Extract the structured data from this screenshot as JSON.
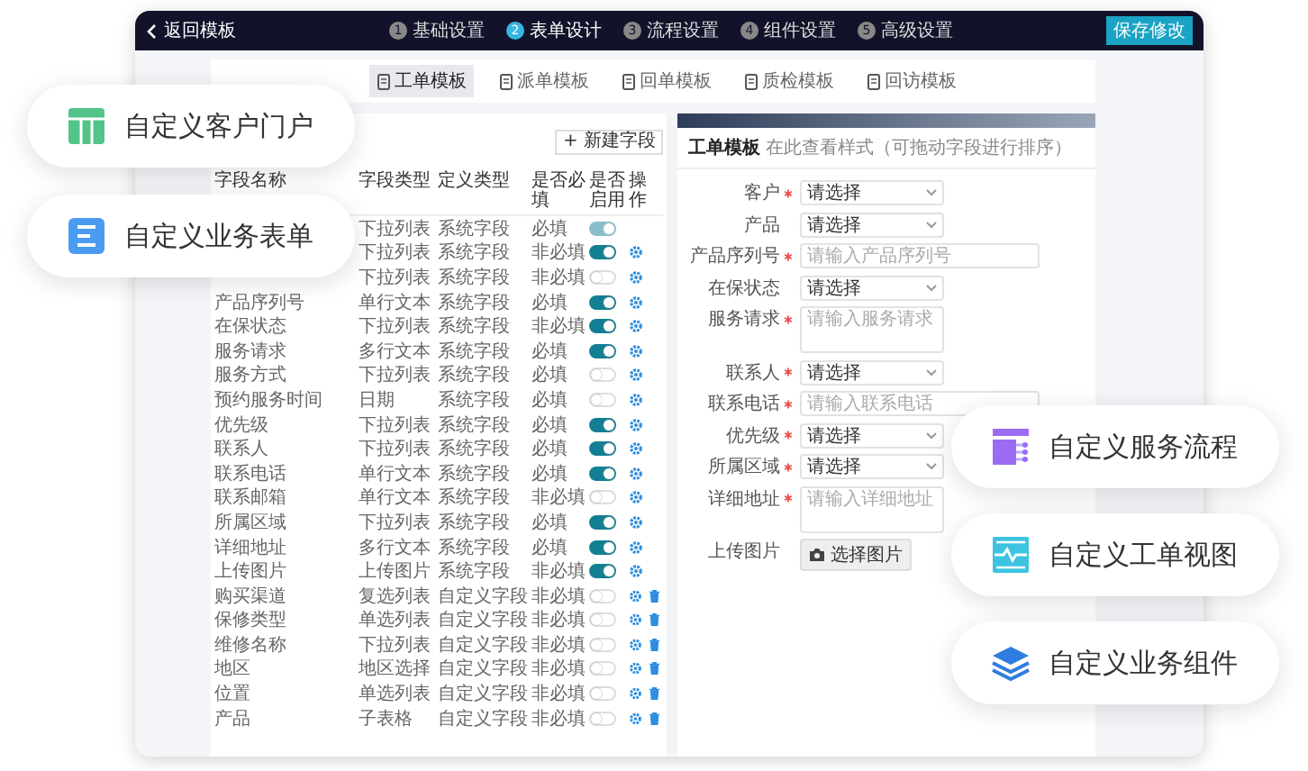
{
  "top_bar": {
    "back_label": "返回模板",
    "steps": [
      {
        "number": "1",
        "label": "基础设置",
        "selected": false
      },
      {
        "number": "2",
        "label": "表单设计",
        "selected": true
      },
      {
        "number": "3",
        "label": "流程设置",
        "selected": false
      },
      {
        "number": "4",
        "label": "组件设置",
        "selected": false
      },
      {
        "number": "5",
        "label": "高级设置",
        "selected": false
      }
    ],
    "save_button": "保存修改"
  },
  "tabs": [
    {
      "label": "工单模板",
      "selected": true
    },
    {
      "label": "派单模板",
      "selected": false
    },
    {
      "label": "回单模板",
      "selected": false
    },
    {
      "label": "质检模板",
      "selected": false
    },
    {
      "label": "回访模板",
      "selected": false
    }
  ],
  "table": {
    "add_button": "+ 新建字段",
    "columns": [
      "字段名称",
      "字段类型",
      "定义类型",
      "是否必填",
      "是否启用",
      "操作"
    ],
    "rows": [
      {
        "type": "下拉列表",
        "definition": "系统字段",
        "required": "必填",
        "enabled": true,
        "locked": true,
        "editable": false,
        "deletable": false
      },
      {
        "type": "下拉列表",
        "definition": "系统字段",
        "required": "非必填",
        "enabled": true,
        "locked": false,
        "editable": true,
        "deletable": false
      },
      {
        "type": "下拉列表",
        "definition": "系统字段",
        "required": "非必填",
        "enabled": false,
        "locked": false,
        "editable": true,
        "deletable": false
      },
      {
        "name": "产品序列号",
        "type": "单行文本",
        "definition": "系统字段",
        "required": "必填",
        "enabled": true,
        "locked": false,
        "editable": true,
        "deletable": false
      },
      {
        "name": "在保状态",
        "type": "下拉列表",
        "definition": "系统字段",
        "required": "非必填",
        "enabled": true,
        "locked": false,
        "editable": true,
        "deletable": false
      },
      {
        "name": "服务请求",
        "type": "多行文本",
        "definition": "系统字段",
        "required": "必填",
        "enabled": true,
        "locked": false,
        "editable": true,
        "deletable": false
      },
      {
        "name": "服务方式",
        "type": "下拉列表",
        "definition": "系统字段",
        "required": "必填",
        "enabled": false,
        "locked": false,
        "editable": true,
        "deletable": false
      },
      {
        "name": "预约服务时间",
        "type": "日期",
        "definition": "系统字段",
        "required": "必填",
        "enabled": false,
        "locked": false,
        "editable": true,
        "deletable": false
      },
      {
        "name": "优先级",
        "type": "下拉列表",
        "definition": "系统字段",
        "required": "必填",
        "enabled": true,
        "locked": false,
        "editable": true,
        "deletable": false
      },
      {
        "name": "联系人",
        "type": "下拉列表",
        "definition": "系统字段",
        "required": "必填",
        "enabled": true,
        "locked": false,
        "editable": true,
        "deletable": false
      },
      {
        "name": "联系电话",
        "type": "单行文本",
        "definition": "系统字段",
        "required": "必填",
        "enabled": true,
        "locked": false,
        "editable": true,
        "deletable": false
      },
      {
        "name": "联系邮箱",
        "type": "单行文本",
        "definition": "系统字段",
        "required": "非必填",
        "enabled": false,
        "locked": false,
        "editable": true,
        "deletable": false
      },
      {
        "name": "所属区域",
        "type": "下拉列表",
        "definition": "系统字段",
        "required": "必填",
        "enabled": true,
        "locked": false,
        "editable": true,
        "deletable": false
      },
      {
        "name": "详细地址",
        "type": "多行文本",
        "definition": "系统字段",
        "required": "必填",
        "enabled": true,
        "locked": false,
        "editable": true,
        "deletable": false
      },
      {
        "name": "上传图片",
        "type": "上传图片",
        "definition": "系统字段",
        "required": "非必填",
        "enabled": true,
        "locked": false,
        "editable": true,
        "deletable": false
      },
      {
        "name": "购买渠道",
        "type": "复选列表",
        "definition": "自定义字段",
        "required": "非必填",
        "enabled": false,
        "locked": false,
        "editable": true,
        "deletable": true
      },
      {
        "name": "保修类型",
        "type": "单选列表",
        "definition": "自定义字段",
        "required": "非必填",
        "enabled": false,
        "locked": false,
        "editable": true,
        "deletable": true
      },
      {
        "name": "维修名称",
        "type": "下拉列表",
        "definition": "自定义字段",
        "required": "非必填",
        "enabled": false,
        "locked": false,
        "editable": true,
        "deletable": true
      },
      {
        "name": "地区",
        "type": "地区选择",
        "definition": "自定义字段",
        "required": "非必填",
        "enabled": false,
        "locked": false,
        "editable": true,
        "deletable": true
      },
      {
        "name": "位置",
        "type": "单选列表",
        "definition": "自定义字段",
        "required": "非必填",
        "enabled": false,
        "locked": false,
        "editable": true,
        "deletable": true
      },
      {
        "name": "产品",
        "type": "子表格",
        "definition": "自定义字段",
        "required": "非必填",
        "enabled": false,
        "locked": false,
        "editable": true,
        "deletable": true
      }
    ]
  },
  "preview": {
    "title": "工单模板",
    "subtitle": "在此查看样式（可拖动字段进行排序）",
    "fields": [
      {
        "kind": "select",
        "label": "客户",
        "required": true,
        "value": "请选择"
      },
      {
        "kind": "select",
        "label": "产品",
        "required": false,
        "value": "请选择"
      },
      {
        "kind": "input",
        "label": "产品序列号",
        "required": true,
        "placeholder": "请输入产品序列号"
      },
      {
        "kind": "select",
        "label": "在保状态",
        "required": false,
        "value": "请选择"
      },
      {
        "kind": "textarea",
        "label": "服务请求",
        "required": true,
        "placeholder": "请输入服务请求"
      },
      {
        "kind": "select",
        "label": "联系人",
        "required": true,
        "value": "请选择"
      },
      {
        "kind": "input",
        "label": "联系电话",
        "required": true,
        "placeholder": "请输入联系电话"
      },
      {
        "kind": "select",
        "label": "优先级",
        "required": true,
        "value": "请选择"
      },
      {
        "kind": "select",
        "label": "所属区域",
        "required": true,
        "value": "请选择"
      },
      {
        "kind": "textarea",
        "label": "详细地址",
        "required": true,
        "placeholder": "请输入详细地址"
      },
      {
        "kind": "upload",
        "label": "上传图片",
        "required": false,
        "button": "选择图片"
      }
    ]
  },
  "feature_cards": [
    {
      "kind": "portal",
      "label": "自定义客户门户",
      "color": "#52c48a"
    },
    {
      "kind": "form",
      "label": "自定义业务表单",
      "color": "#4a9cf0"
    },
    {
      "kind": "flow",
      "label": "自定义服务流程",
      "color": "#9b6cf2"
    },
    {
      "kind": "view",
      "label": "自定义工单视图",
      "color": "#3cc4e0"
    },
    {
      "kind": "component",
      "label": "自定义业务组件",
      "color": "#2f7de0"
    }
  ]
}
